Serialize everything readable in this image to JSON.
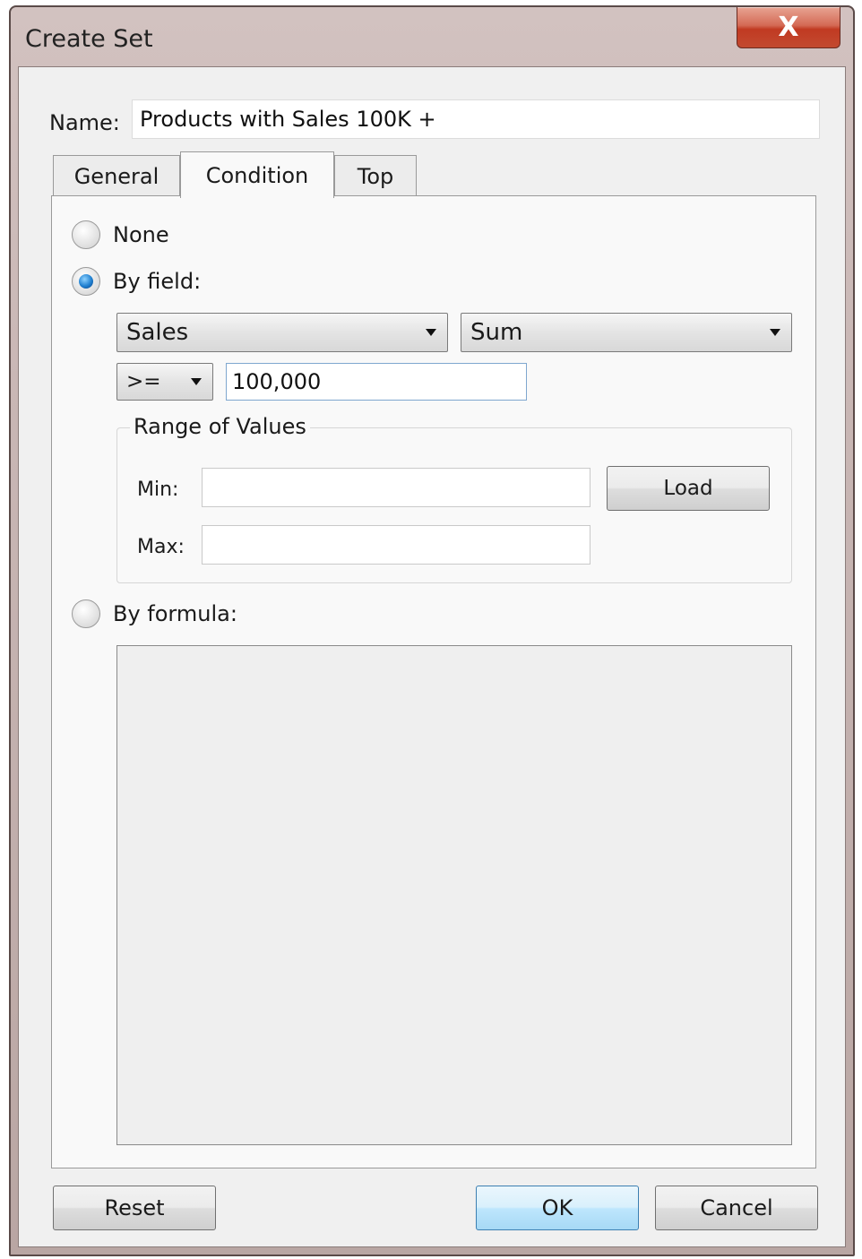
{
  "window": {
    "title": "Create Set",
    "close_glyph": "X"
  },
  "name_field": {
    "label": "Name:",
    "value": "Products with Sales 100K +"
  },
  "tabs": [
    {
      "label": "General",
      "active": false
    },
    {
      "label": "Condition",
      "active": true
    },
    {
      "label": "Top",
      "active": false
    }
  ],
  "condition": {
    "options": {
      "none": {
        "label": "None",
        "selected": false
      },
      "by_field": {
        "label": "By field:",
        "selected": true
      },
      "by_formula": {
        "label": "By formula:",
        "selected": false
      }
    },
    "field_select": "Sales",
    "aggregation_select": "Sum",
    "operator_select": ">=",
    "value": "100,000",
    "range": {
      "legend": "Range of Values",
      "min_label": "Min:",
      "max_label": "Max:",
      "min_value": "",
      "max_value": "",
      "load_label": "Load"
    },
    "formula_text": ""
  },
  "buttons": {
    "reset": "Reset",
    "ok": "OK",
    "cancel": "Cancel"
  },
  "colors": {
    "close_button": "#c84a30",
    "radio_selected": "#1f7fd0",
    "ok_border": "#3c7fb1"
  }
}
